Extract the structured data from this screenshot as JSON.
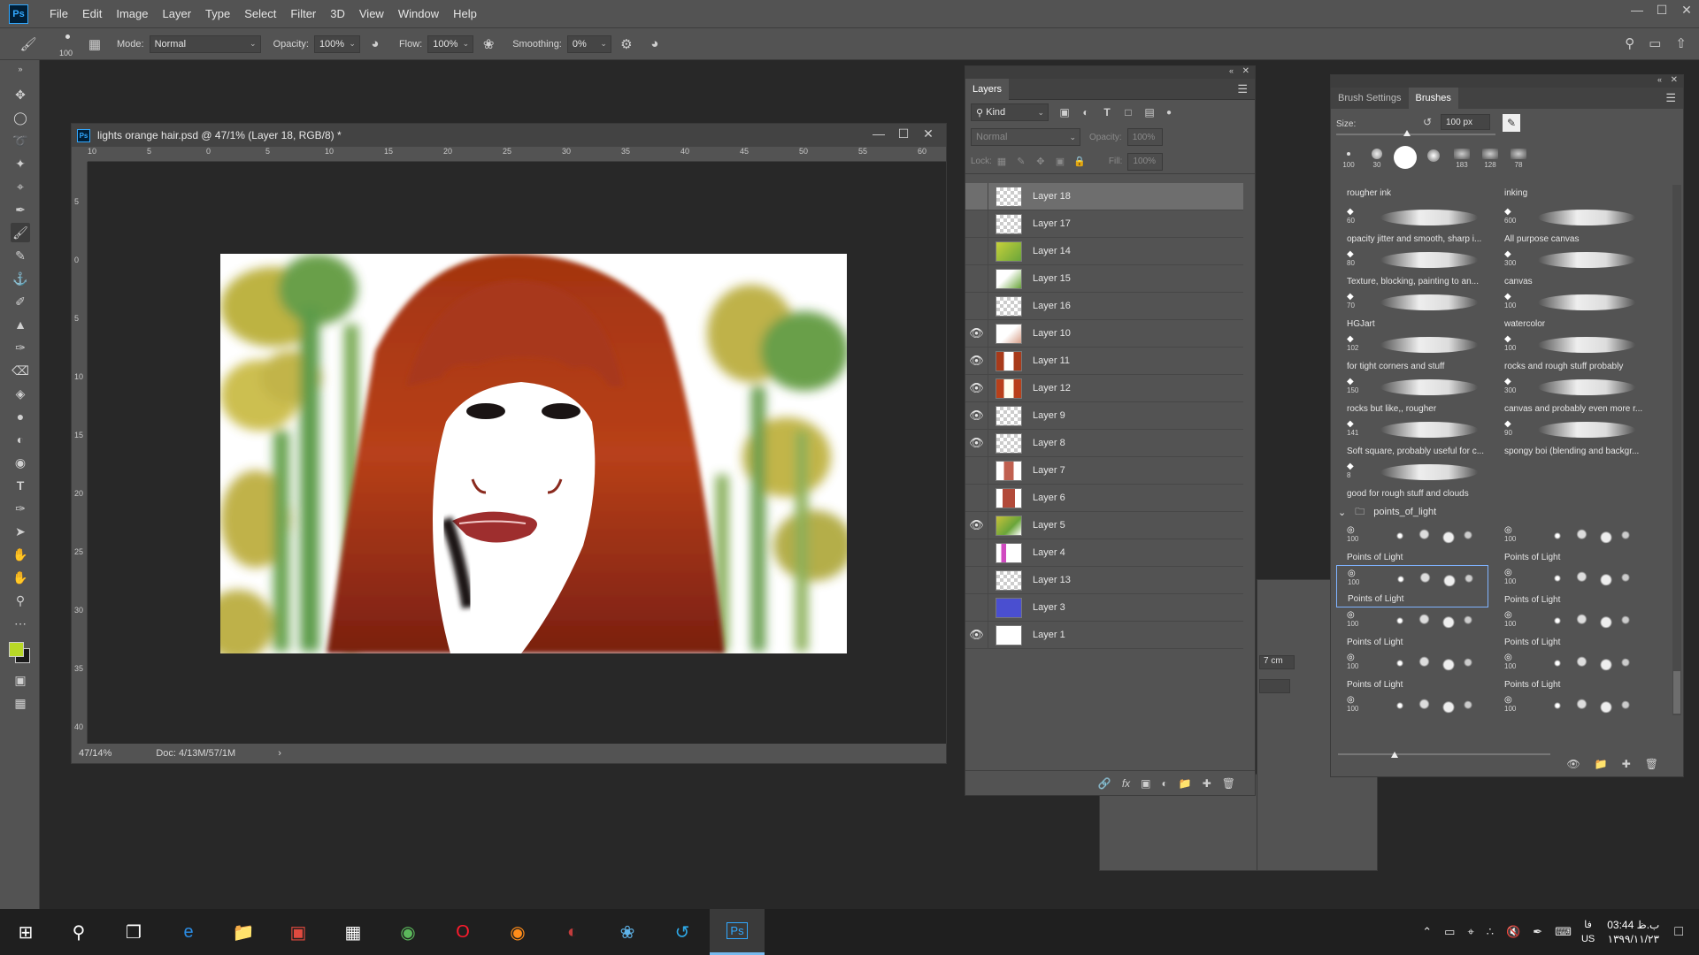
{
  "app": {
    "logo": "Ps",
    "menu": [
      "File",
      "Edit",
      "Image",
      "Layer",
      "Type",
      "Select",
      "Filter",
      "3D",
      "View",
      "Window",
      "Help"
    ]
  },
  "options": {
    "brush_size": "100",
    "mode_label": "Mode:",
    "mode_value": "Normal",
    "opacity_label": "Opacity:",
    "opacity_value": "100%",
    "flow_label": "Flow:",
    "flow_value": "100%",
    "smoothing_label": "Smoothing:",
    "smoothing_value": "0%"
  },
  "document": {
    "title": "lights orange hair.psd @ 47/1% (Layer 18, RGB/8) *",
    "ruler_h": [
      "10",
      "5",
      "0",
      "5",
      "10",
      "15",
      "20",
      "25",
      "30",
      "35",
      "40",
      "45",
      "50",
      "55",
      "60"
    ],
    "ruler_v": [
      "5",
      "0",
      "5",
      "10",
      "15",
      "20",
      "25",
      "30",
      "35",
      "40"
    ],
    "zoom": "47/14%",
    "doc_info": "Doc: 4/13M/57/1M"
  },
  "layers": {
    "tab": "Layers",
    "kind": "Kind",
    "blend": "Normal",
    "opacity_label": "Opacity:",
    "opacity_value": "100%",
    "lock_label": "Lock:",
    "fill_label": "Fill:",
    "fill_value": "100%",
    "items": [
      {
        "name": "Layer 18",
        "visible": false,
        "selected": true
      },
      {
        "name": "Layer 17",
        "visible": false
      },
      {
        "name": "Layer 14",
        "visible": false
      },
      {
        "name": "Layer 15",
        "visible": false
      },
      {
        "name": "Layer 16",
        "visible": false
      },
      {
        "name": "Layer 10",
        "visible": true
      },
      {
        "name": "Layer 11",
        "visible": true
      },
      {
        "name": "Layer 12",
        "visible": true
      },
      {
        "name": "Layer 9",
        "visible": true
      },
      {
        "name": "Layer 8",
        "visible": true
      },
      {
        "name": "Layer 7",
        "visible": false
      },
      {
        "name": "Layer 6",
        "visible": false
      },
      {
        "name": "Layer 5",
        "visible": true
      },
      {
        "name": "Layer 4",
        "visible": false
      },
      {
        "name": "Layer 13",
        "visible": false
      },
      {
        "name": "Layer 3",
        "visible": false
      },
      {
        "name": "Layer 1",
        "visible": true
      }
    ]
  },
  "brushes": {
    "tabs": [
      "Brush Settings",
      "Brushes"
    ],
    "size_label": "Size:",
    "size_value": "100 px",
    "presets": [
      "100",
      "30",
      "",
      "",
      "183",
      "128",
      "78"
    ],
    "rows": [
      [
        {
          "num": "",
          "name": "rougher ink"
        },
        {
          "num": "",
          "name": "inking"
        }
      ],
      [
        {
          "num": "60",
          "name": "opacity jitter and smooth, sharp i..."
        },
        {
          "num": "600",
          "name": "All purpose canvas"
        }
      ],
      [
        {
          "num": "80",
          "name": "Texture, blocking, painting to an..."
        },
        {
          "num": "300",
          "name": "canvas"
        }
      ],
      [
        {
          "num": "70",
          "name": "HGJart"
        },
        {
          "num": "100",
          "name": "watercolor"
        }
      ],
      [
        {
          "num": "102",
          "name": "for tight corners and stuff"
        },
        {
          "num": "100",
          "name": "rocks and rough stuff probably"
        }
      ],
      [
        {
          "num": "150",
          "name": "rocks but like,, rougher"
        },
        {
          "num": "300",
          "name": "canvas and probably even more r..."
        }
      ],
      [
        {
          "num": "141",
          "name": "Soft square, probably useful for c..."
        },
        {
          "num": "90",
          "name": "spongy boi (blending and backgr..."
        }
      ],
      [
        {
          "num": "8",
          "name": "good for rough stuff and clouds"
        }
      ]
    ],
    "group_name": "points_of_light",
    "light_rows": [
      [
        {
          "num": "100",
          "name": "Points of Light"
        },
        {
          "num": "100",
          "name": "Points of Light"
        }
      ],
      [
        {
          "num": "100",
          "name": "Points of Light"
        },
        {
          "num": "100",
          "name": "Points of Light"
        }
      ],
      [
        {
          "num": "100",
          "name": "Points of Light"
        },
        {
          "num": "100",
          "name": "Points of Light"
        }
      ],
      [
        {
          "num": "100",
          "name": "Points of Light"
        },
        {
          "num": "100",
          "name": "Points of Light"
        }
      ],
      [
        {
          "num": "100",
          "name": "Points of Light"
        },
        {
          "num": "100",
          "name": "Points of Light"
        }
      ]
    ]
  },
  "dialog_remnant": {
    "value": "7 cm"
  },
  "taskbar": {
    "clock_time": "03:44 ب.ظ",
    "clock_date": "۱۳۹۹/۱۱/۲۳",
    "lang": "فا",
    "lang2": "US"
  },
  "colors": {
    "foreground": "#b8d827",
    "background": "#1a1a1a",
    "accent": "#31a8ff"
  }
}
